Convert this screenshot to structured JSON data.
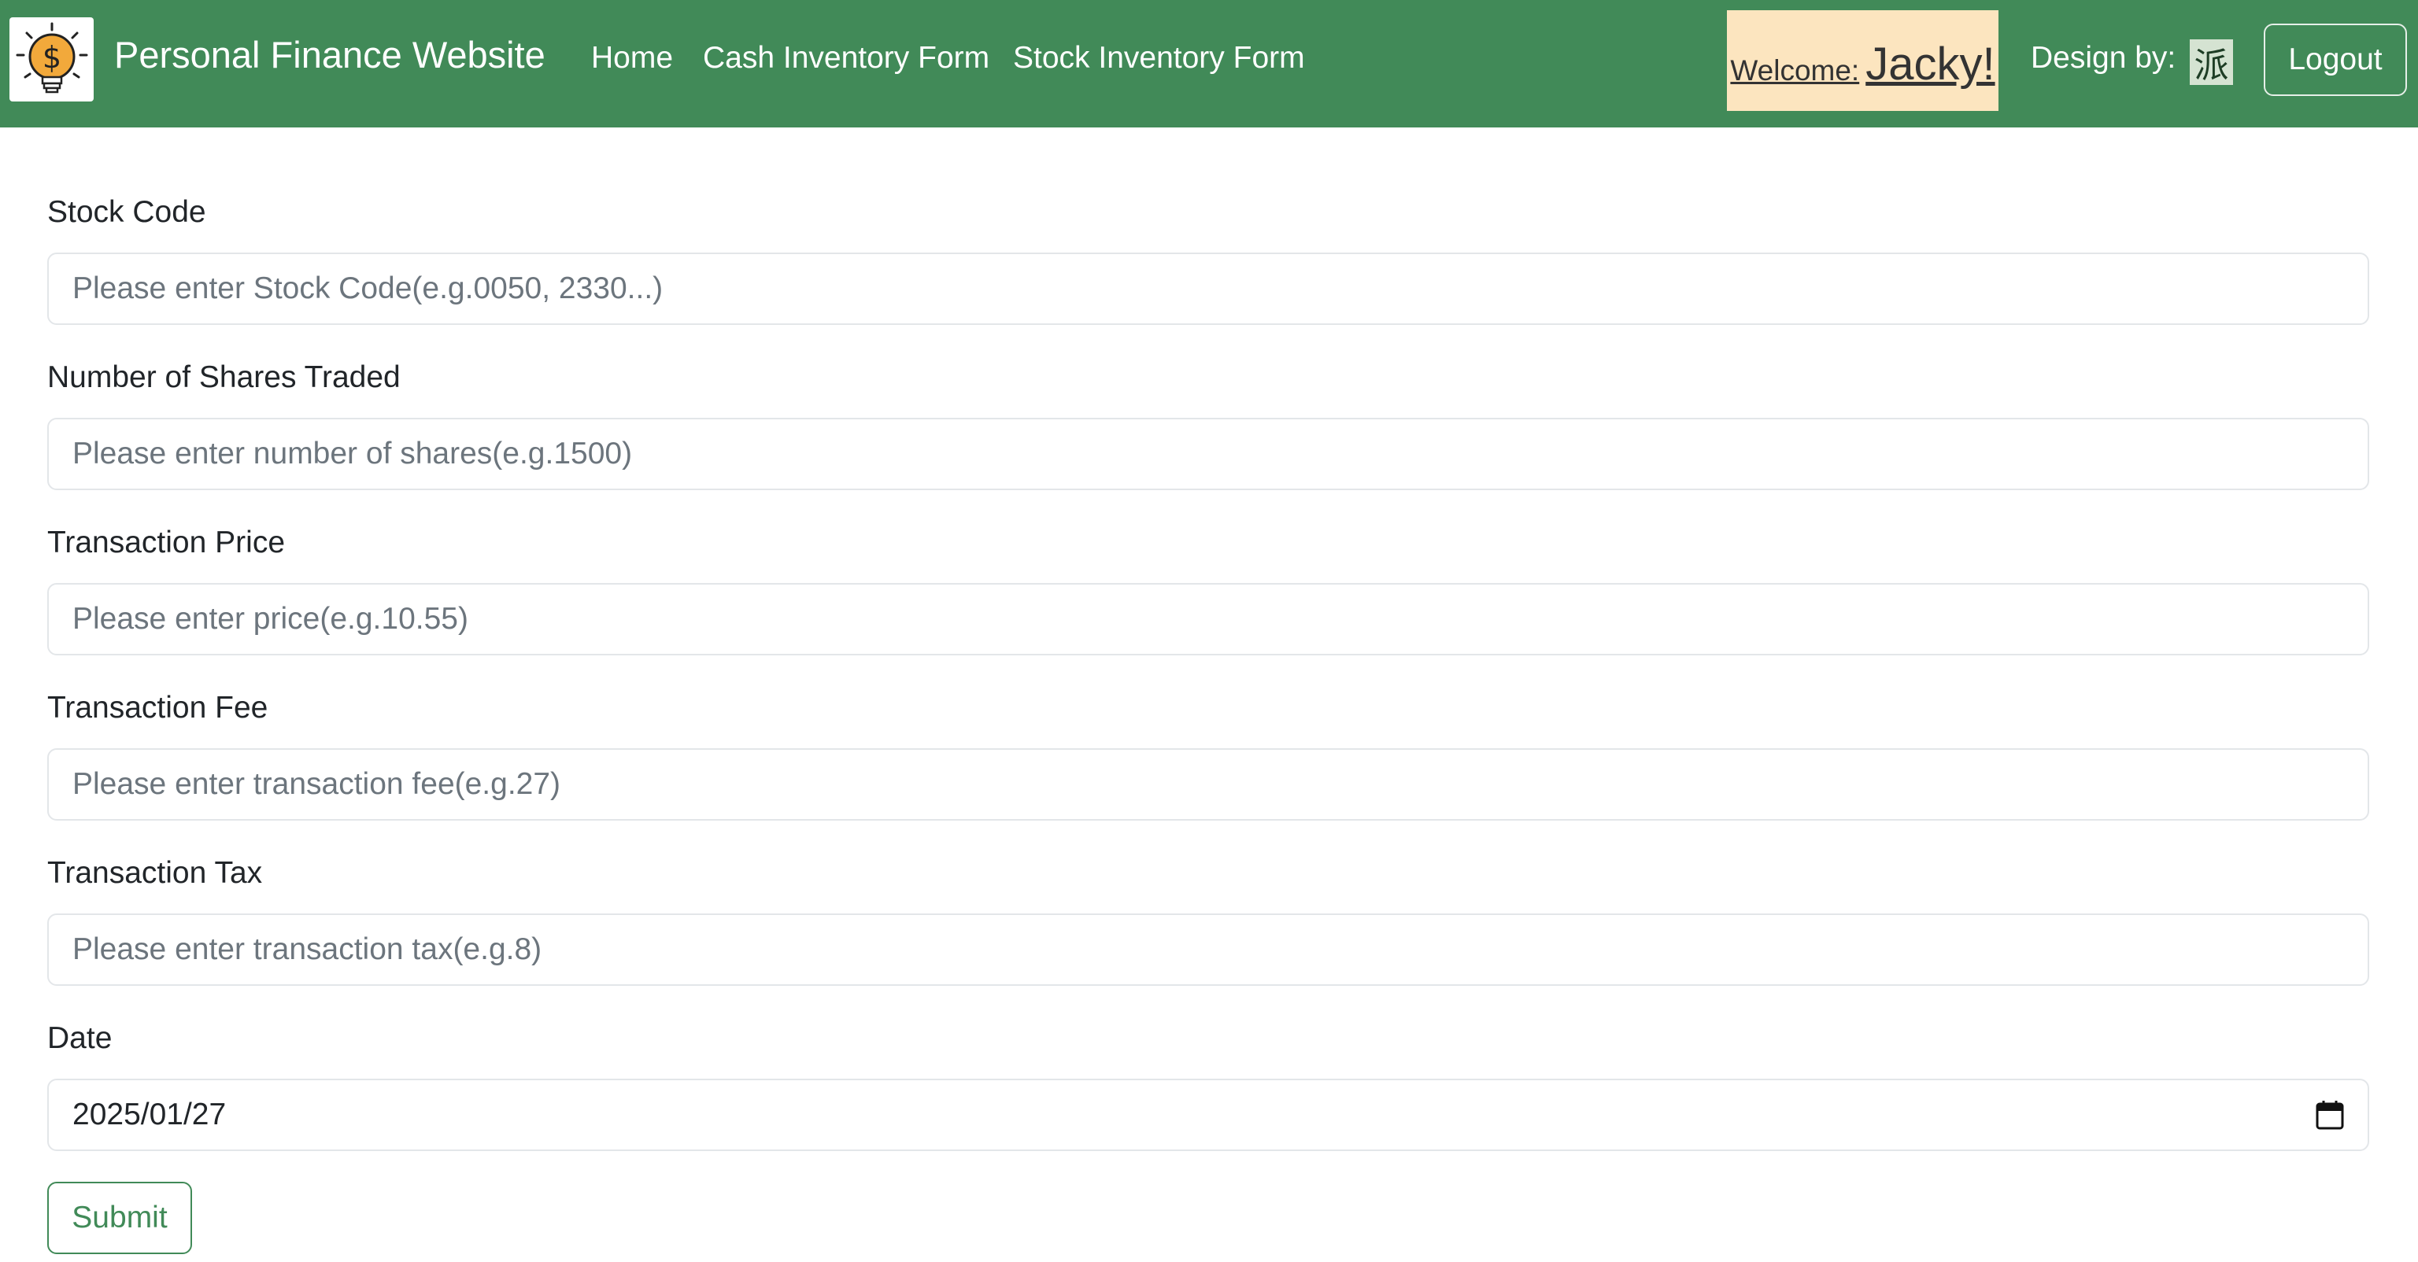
{
  "navbar": {
    "brand_title": "Personal Finance Website",
    "brand_logo_icon": "lightbulb-dollar-icon",
    "links": [
      {
        "label": "Home"
      },
      {
        "label": "Cash Inventory Form"
      },
      {
        "label": "Stock Inventory Form"
      }
    ],
    "welcome_label": "Welcome:",
    "welcome_name": "Jacky!",
    "design_by_label": "Design by:",
    "design_badge": "派",
    "logout_label": "Logout",
    "colors": {
      "background": "#418a58",
      "welcome_bg": "#fce5bf"
    }
  },
  "form": {
    "fields": [
      {
        "label": "Stock Code",
        "placeholder": "Please enter Stock Code(e.g.0050, 2330...)",
        "value": ""
      },
      {
        "label": "Number of Shares Traded",
        "placeholder": "Please enter number of shares(e.g.1500)",
        "value": ""
      },
      {
        "label": "Transaction Price",
        "placeholder": "Please enter price(e.g.10.55)",
        "value": ""
      },
      {
        "label": "Transaction Fee",
        "placeholder": "Please enter transaction fee(e.g.27)",
        "value": ""
      },
      {
        "label": "Transaction Tax",
        "placeholder": "Please enter transaction tax(e.g.8)",
        "value": ""
      }
    ],
    "date": {
      "label": "Date",
      "value": "2025/01/27",
      "icon": "calendar-icon"
    },
    "submit_label": "Submit"
  }
}
